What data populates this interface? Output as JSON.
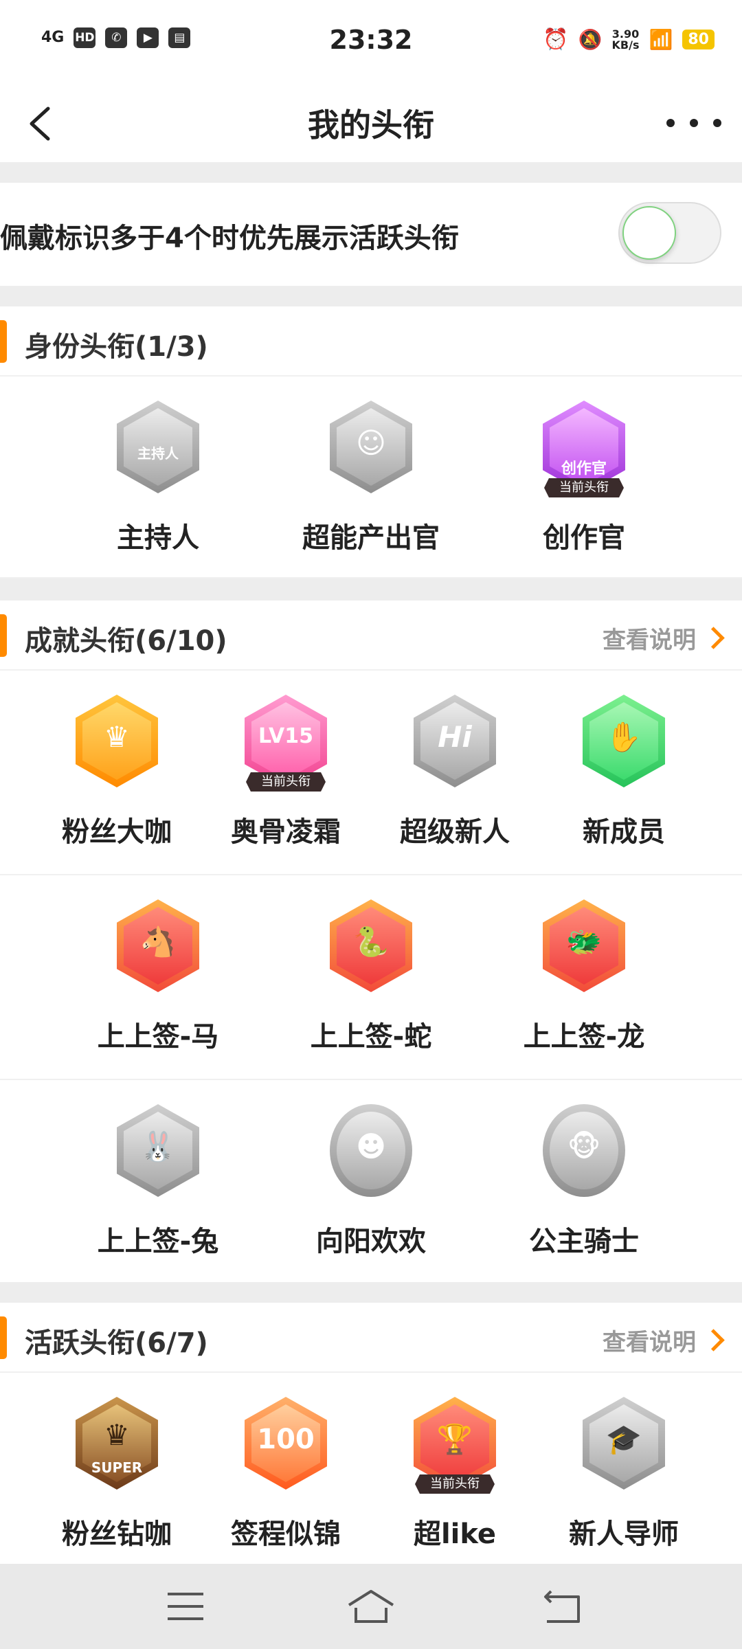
{
  "status_bar": {
    "network": "4G",
    "hd": "HD",
    "time": "23:32",
    "speed_value": "3.90",
    "speed_unit": "KB/s",
    "battery": "80"
  },
  "header": {
    "title": "我的头衔"
  },
  "toggle_row": {
    "label": "佩戴标识多于4个时优先展示活跃头衔",
    "enabled": false
  },
  "sections": {
    "identity": {
      "title": "身份头衔(1/3)",
      "badges": [
        {
          "name": "主持人",
          "tag": "",
          "art": "主持人",
          "color": "gray"
        },
        {
          "name": "超能产出官",
          "tag": "",
          "art": "",
          "color": "gray"
        },
        {
          "name": "创作官",
          "tag": "当前头衔",
          "art": "创作官",
          "color": "purple"
        }
      ]
    },
    "achievement": {
      "title": "成就头衔(6/10)",
      "link": "查看说明",
      "badges": [
        {
          "name": "粉丝大咖",
          "tag": "",
          "art": "",
          "color": "orange"
        },
        {
          "name": "奥骨凌霜",
          "tag": "当前头衔",
          "art": "LV15",
          "color": "pink"
        },
        {
          "name": "超级新人",
          "tag": "",
          "art": "Hi",
          "color": "gray"
        },
        {
          "name": "新成员",
          "tag": "",
          "art": "",
          "color": "green"
        },
        {
          "name": "上上签-马",
          "tag": "",
          "art": "",
          "color": "red"
        },
        {
          "name": "上上签-蛇",
          "tag": "",
          "art": "",
          "color": "red"
        },
        {
          "name": "上上签-龙",
          "tag": "",
          "art": "",
          "color": "red"
        },
        {
          "name": "上上签-兔",
          "tag": "",
          "art": "",
          "color": "gray"
        },
        {
          "name": "向阳欢欢",
          "tag": "",
          "art": "",
          "color": "gray"
        },
        {
          "name": "公主骑士",
          "tag": "",
          "art": "",
          "color": "gray"
        }
      ]
    },
    "active": {
      "title": "活跃头衔(6/7)",
      "link": "查看说明",
      "badges": [
        {
          "name": "粉丝钻咖",
          "tag": "",
          "art": "SUPER",
          "color": "brown"
        },
        {
          "name": "签程似锦",
          "tag": "",
          "art": "100",
          "color": "orange2"
        },
        {
          "name": "超like",
          "tag": "当前头衔",
          "art": "",
          "color": "red"
        },
        {
          "name": "新人导师",
          "tag": "",
          "art": "",
          "color": "gray"
        }
      ]
    }
  },
  "colors": {
    "accent": "#ff8a00",
    "battery": "#f5c400"
  }
}
